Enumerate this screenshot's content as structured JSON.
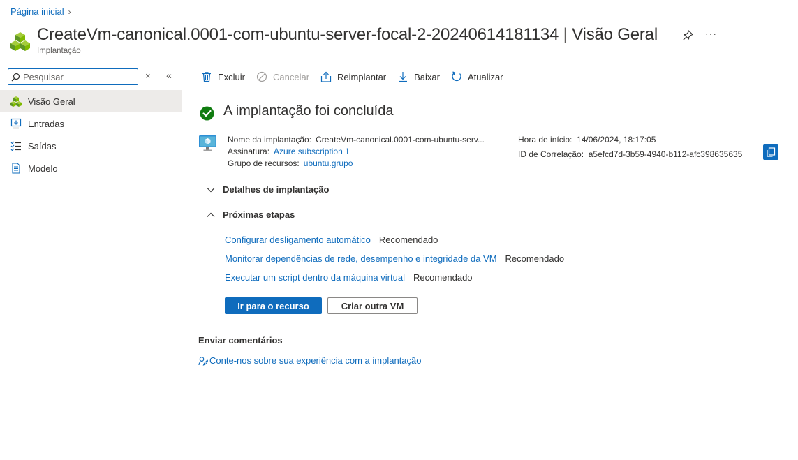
{
  "breadcrumb": {
    "home": "Página inicial",
    "chevron": "›"
  },
  "header": {
    "title": "CreateVm-canonical.0001-com-ubuntu-server-focal-2-20240614181134",
    "separator": "|",
    "section": "Visão Geral",
    "subtitle": "Implantação",
    "more": "···",
    "icons": {
      "resource": "deployment-cubes-icon",
      "pin": "pin-icon",
      "more": "more-icon"
    }
  },
  "sidebar": {
    "search_placeholder": "Pesquisar",
    "clear": "×",
    "collapse": "«",
    "items": [
      {
        "label": "Visão Geral",
        "icon": "overview-icon",
        "active": true
      },
      {
        "label": "Entradas",
        "icon": "inputs-icon",
        "active": false
      },
      {
        "label": "Saídas",
        "icon": "outputs-icon",
        "active": false
      },
      {
        "label": "Modelo",
        "icon": "template-icon",
        "active": false
      }
    ]
  },
  "toolbar": {
    "delete": "Excluir",
    "cancel": "Cancelar",
    "redeploy": "Reimplantar",
    "download": "Baixar",
    "refresh": "Atualizar"
  },
  "main": {
    "status_title": "A implantação foi concluída",
    "info": {
      "deployment_name_label": "Nome da implantação:",
      "deployment_name_value": "CreateVm-canonical.0001-com-ubuntu-serv...",
      "subscription_label": "Assinatura:",
      "subscription_value": "Azure subscription 1",
      "resource_group_label": "Grupo de recursos:",
      "resource_group_value": "ubuntu.grupo",
      "start_time_label": "Hora de início:",
      "start_time_value": "14/06/2024, 18:17:05",
      "correlation_label": "ID de Correlação:",
      "correlation_value": "a5efcd7d-3b59-4940-b112-afc398635635"
    },
    "sections": {
      "details": "Detalhes de implantação",
      "next_steps": "Próximas etapas"
    },
    "next_steps": [
      {
        "link": "Configurar desligamento automático",
        "tag": "Recomendado"
      },
      {
        "link": "Monitorar dependências de rede, desempenho e integridade da VM",
        "tag": "Recomendado"
      },
      {
        "link": "Executar um script dentro da máquina virtual",
        "tag": "Recomendado"
      }
    ],
    "buttons": {
      "go_to_resource": "Ir para o recurso",
      "create_another": "Criar outra VM"
    },
    "feedback": {
      "title": "Enviar comentários",
      "link": "Conte-nos sobre sua experiência com a implantação"
    }
  },
  "colors": {
    "accent": "#0f6cbd",
    "success": "#107c10",
    "nav_active_bg": "#edebe9",
    "text": "#323130"
  }
}
